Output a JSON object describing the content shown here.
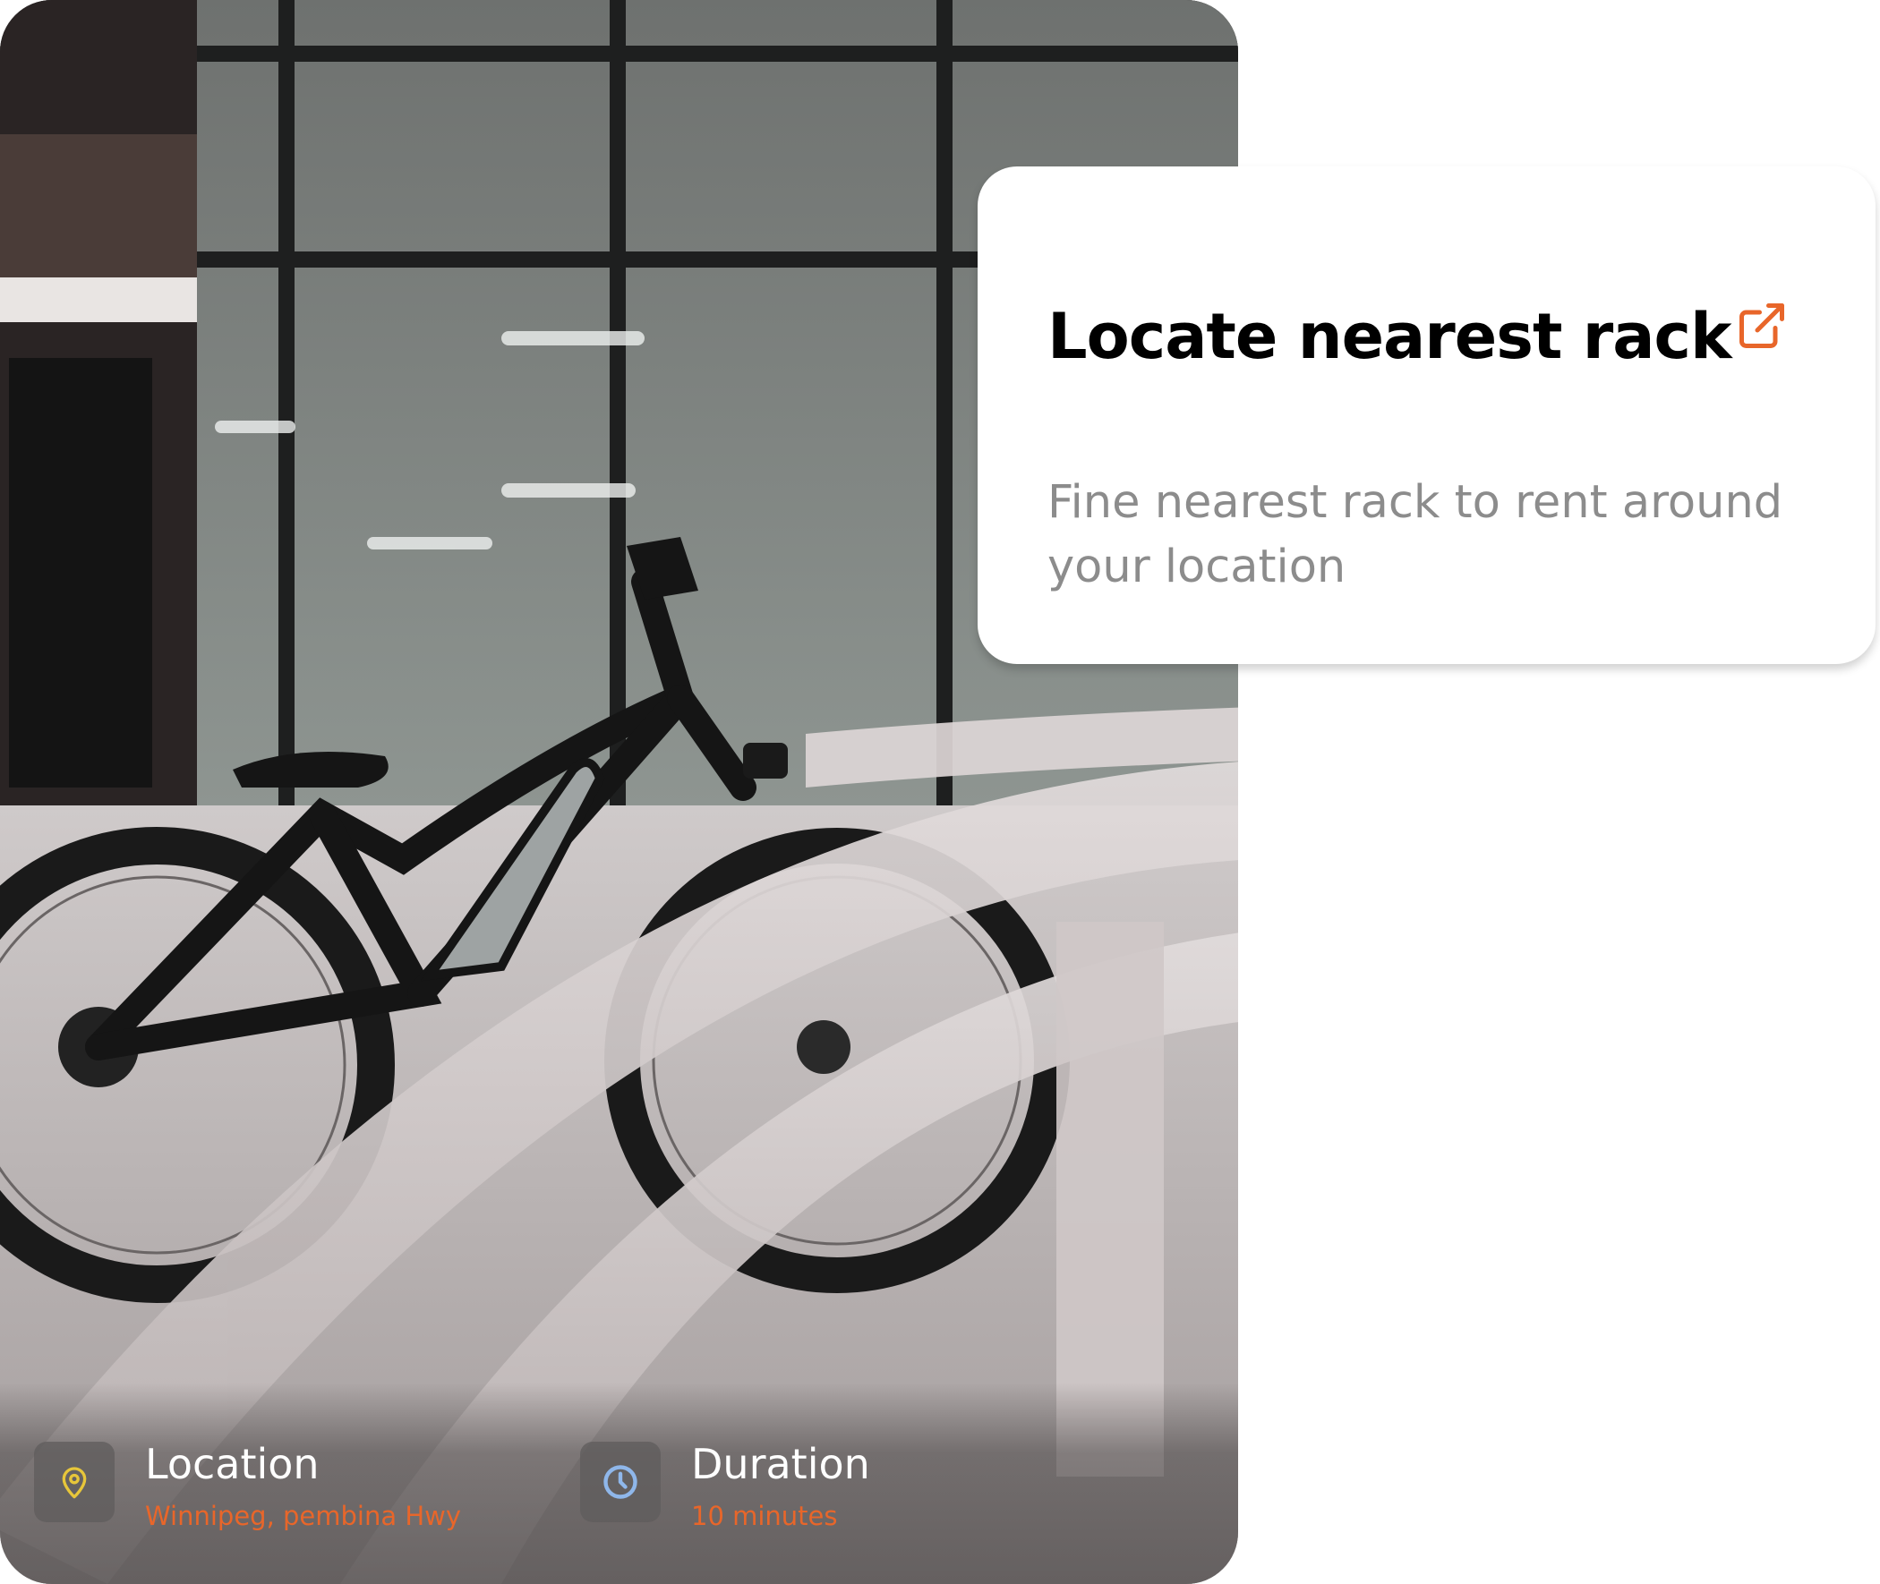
{
  "locate_card": {
    "title": "Locate nearest rack",
    "description": "Fine nearest rack to rent around your location",
    "link_icon": "external-link-icon",
    "accent_color": "#e8662a"
  },
  "photo": {
    "subject": "bike-photo"
  },
  "info": {
    "location": {
      "title": "Location",
      "value": "Winnipeg, pembina Hwy",
      "icon": "map-pin-icon",
      "icon_color": "#e7c63a"
    },
    "duration": {
      "title": "Duration",
      "value": "10 minutes",
      "icon": "clock-icon",
      "icon_color": "#8fb7ea"
    }
  }
}
